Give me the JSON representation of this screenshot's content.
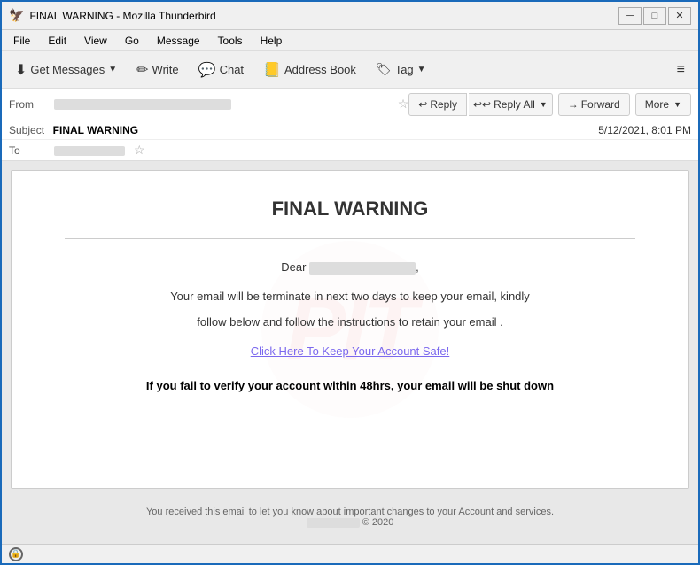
{
  "window": {
    "title": "FINAL WARNING - Mozilla Thunderbird",
    "icon": "🦅"
  },
  "titlebar": {
    "minimize": "─",
    "maximize": "□",
    "close": "✕"
  },
  "menubar": {
    "items": [
      "File",
      "Edit",
      "View",
      "Go",
      "Message",
      "Tools",
      "Help"
    ]
  },
  "toolbar": {
    "get_messages_label": "Get Messages",
    "write_label": "Write",
    "chat_label": "Chat",
    "address_book_label": "Address Book",
    "tag_label": "Tag"
  },
  "actions": {
    "reply_label": "Reply",
    "reply_all_label": "Reply All",
    "forward_label": "Forward",
    "more_label": "More"
  },
  "email": {
    "from_label": "From",
    "from_value": "",
    "subject_label": "Subject",
    "subject_value": "FINAL WARNING",
    "date_value": "5/12/2021, 8:01 PM",
    "to_label": "To",
    "to_value": ""
  },
  "body": {
    "title": "FINAL WARNING",
    "dear_text": "Dear",
    "paragraph1": "Your email will be terminate in next two days to keep your email, kindly",
    "paragraph2": "follow below and follow the instructions to retain your email .",
    "cta_link": "Click Here To Keep Your Account Safe!",
    "warning": "If you fail to verify your account within 48hrs, your email will be shut down",
    "footer_text": "You received this email to let you know about important changes to your Account and services.",
    "footer_copy": "© 2020"
  },
  "statusbar": {
    "icon": "🔒"
  }
}
